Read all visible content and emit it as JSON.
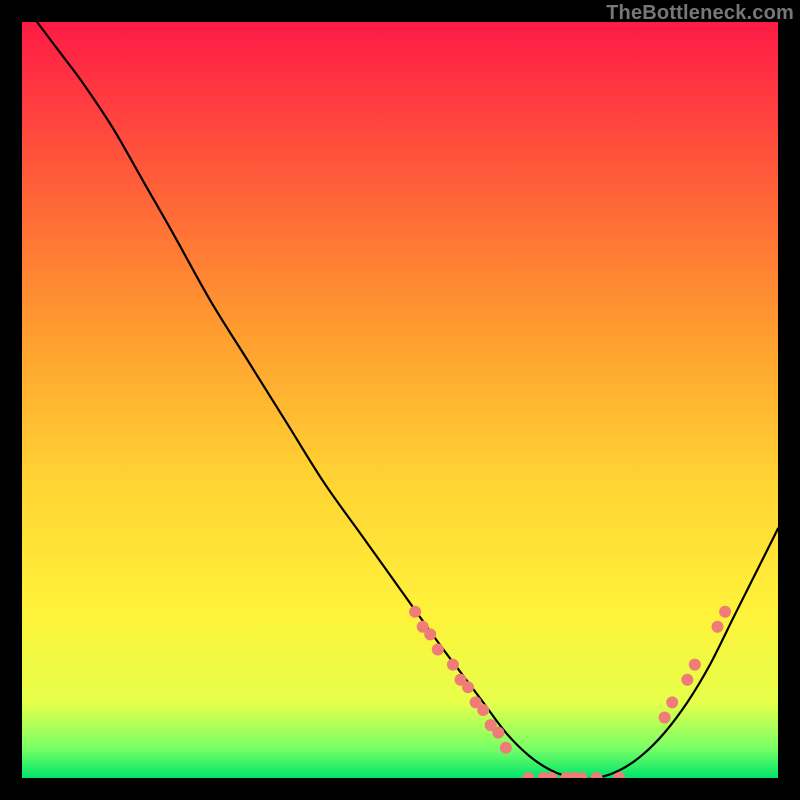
{
  "watermark": "TheBottleneck.com",
  "chart_data": {
    "type": "line",
    "title": "",
    "xlabel": "",
    "ylabel": "",
    "xlim": [
      0,
      100
    ],
    "ylim": [
      0,
      100
    ],
    "grid": false,
    "legend": false,
    "background_gradient": {
      "stops": [
        {
          "offset": 0.0,
          "color": "#ff1a46"
        },
        {
          "offset": 0.2,
          "color": "#ff5a3a"
        },
        {
          "offset": 0.4,
          "color": "#ff9a2f"
        },
        {
          "offset": 0.6,
          "color": "#ffd233"
        },
        {
          "offset": 0.78,
          "color": "#fff23a"
        },
        {
          "offset": 0.9,
          "color": "#e6ff4a"
        },
        {
          "offset": 0.96,
          "color": "#7aff66"
        },
        {
          "offset": 1.0,
          "color": "#00e56a"
        }
      ]
    },
    "series": [
      {
        "name": "curve",
        "color": "#000000",
        "x": [
          2,
          5,
          8,
          12,
          16,
          20,
          25,
          30,
          35,
          40,
          45,
          50,
          55,
          58,
          61,
          64,
          67,
          70,
          73,
          76,
          79,
          82,
          85,
          88,
          91,
          94,
          97,
          100
        ],
        "y": [
          100,
          96,
          92,
          86,
          79,
          72,
          63,
          55,
          47,
          39,
          32,
          25,
          18,
          14,
          10,
          6,
          3,
          1,
          0,
          0,
          1,
          3,
          6,
          10,
          15,
          21,
          27,
          33
        ]
      }
    ],
    "markers": {
      "color": "#f07c78",
      "radius": 6,
      "points": [
        {
          "x": 52,
          "y": 22
        },
        {
          "x": 53,
          "y": 20
        },
        {
          "x": 54,
          "y": 19
        },
        {
          "x": 55,
          "y": 17
        },
        {
          "x": 57,
          "y": 15
        },
        {
          "x": 58,
          "y": 13
        },
        {
          "x": 59,
          "y": 12
        },
        {
          "x": 60,
          "y": 10
        },
        {
          "x": 61,
          "y": 9
        },
        {
          "x": 62,
          "y": 7
        },
        {
          "x": 63,
          "y": 6
        },
        {
          "x": 64,
          "y": 4
        },
        {
          "x": 67,
          "y": 0
        },
        {
          "x": 69,
          "y": 0
        },
        {
          "x": 70,
          "y": 0
        },
        {
          "x": 72,
          "y": 0
        },
        {
          "x": 73,
          "y": 0
        },
        {
          "x": 74,
          "y": 0
        },
        {
          "x": 76,
          "y": 0
        },
        {
          "x": 79,
          "y": 0
        },
        {
          "x": 85,
          "y": 8
        },
        {
          "x": 86,
          "y": 10
        },
        {
          "x": 88,
          "y": 13
        },
        {
          "x": 89,
          "y": 15
        },
        {
          "x": 92,
          "y": 20
        },
        {
          "x": 93,
          "y": 22
        }
      ]
    }
  }
}
